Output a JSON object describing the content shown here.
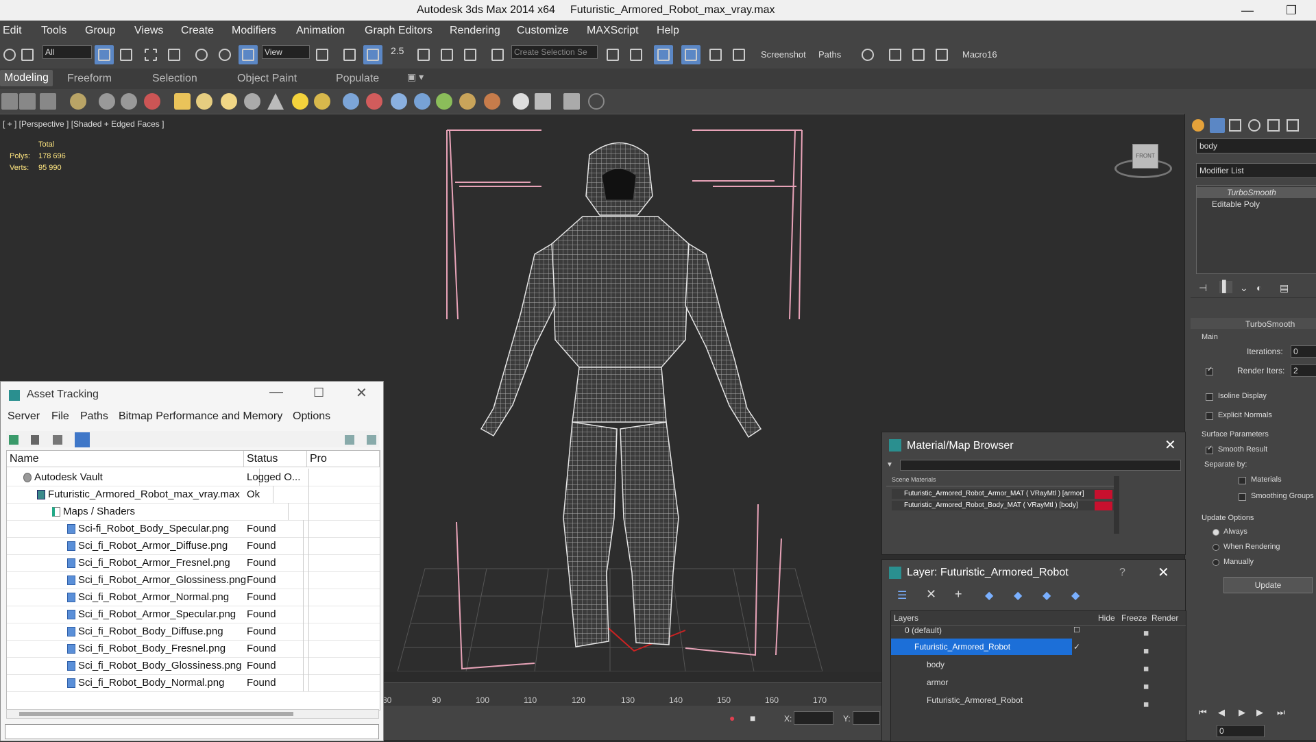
{
  "window": {
    "app_title": "Autodesk 3ds Max  2014 x64",
    "file_title": "Futuristic_Armored_Robot_max_vray.max",
    "minimize": "—",
    "maximize": "❐"
  },
  "menubar": [
    "Edit",
    "Tools",
    "Group",
    "Views",
    "Create",
    "Modifiers",
    "Animation",
    "Graph Editors",
    "Rendering",
    "Customize",
    "MAXScript",
    "Help"
  ],
  "toolbar": {
    "selection_filter": "All",
    "view_dropdown": "View",
    "snap_label": "2.5",
    "selection_set_placeholder": "Create Selection Se",
    "labels": [
      "Screenshot",
      "Paths",
      "Macro16"
    ]
  },
  "ribbon_tabs": [
    "Modeling",
    "Freeform",
    "Selection",
    "Object Paint",
    "Populate"
  ],
  "viewport": {
    "label": "[ + ] [Perspective ] [Shaded + Edged Faces ]",
    "stats_header": "Total",
    "polys_label": "Polys:",
    "polys_value": "178 696",
    "verts_label": "Verts:",
    "verts_value": "95 990",
    "viewcube_label": "FRONT"
  },
  "timeline": {
    "ticks": [
      "80",
      "90",
      "100",
      "110",
      "120",
      "130",
      "140",
      "150",
      "160",
      "170"
    ],
    "x_label": "X:",
    "y_label": "Y:"
  },
  "command_panel": {
    "object_name": "body",
    "modifier_list": "Modifier List",
    "stack": [
      "TurboSmooth",
      "Editable Poly"
    ],
    "rollout_title": "TurboSmooth",
    "main_label": "Main",
    "iterations_label": "Iterations:",
    "iterations_value": "0",
    "render_iters_label": "Render Iters:",
    "render_iters_value": "2",
    "isoline_label": "Isoline Display",
    "explicit_normals_label": "Explicit Normals",
    "surface_params_label": "Surface Parameters",
    "smooth_result_label": "Smooth Result",
    "separate_by_label": "Separate by:",
    "materials_label": "Materials",
    "smoothing_groups_label": "Smoothing Groups",
    "update_options_label": "Update Options",
    "always_label": "Always",
    "when_rendering_label": "When Rendering",
    "manually_label": "Manually",
    "update_button": "Update",
    "frame_value": "0"
  },
  "asset_tracking": {
    "title": "Asset Tracking",
    "menu": [
      "Server",
      "File",
      "Paths",
      "Bitmap Performance and Memory",
      "Options"
    ],
    "columns": [
      "Name",
      "Status",
      "Pro"
    ],
    "rows": [
      {
        "name": "Autodesk Vault",
        "status": "Logged O...",
        "indent": 0,
        "icon": "vault"
      },
      {
        "name": "Futuristic_Armored_Robot_max_vray.max",
        "status": "Ok",
        "indent": 1,
        "icon": "max"
      },
      {
        "name": "Maps / Shaders",
        "status": "",
        "indent": 2,
        "icon": "folder"
      },
      {
        "name": "Sci-fi_Robot_Body_Specular.png",
        "status": "Found",
        "indent": 3,
        "icon": "file"
      },
      {
        "name": "Sci_fi_Robot_Armor_Diffuse.png",
        "status": "Found",
        "indent": 3,
        "icon": "file"
      },
      {
        "name": "Sci_fi_Robot_Armor_Fresnel.png",
        "status": "Found",
        "indent": 3,
        "icon": "file"
      },
      {
        "name": "Sci_fi_Robot_Armor_Glossiness.png",
        "status": "Found",
        "indent": 3,
        "icon": "file"
      },
      {
        "name": "Sci_fi_Robot_Armor_Normal.png",
        "status": "Found",
        "indent": 3,
        "icon": "file"
      },
      {
        "name": "Sci_fi_Robot_Armor_Specular.png",
        "status": "Found",
        "indent": 3,
        "icon": "file"
      },
      {
        "name": "Sci_fi_Robot_Body_Diffuse.png",
        "status": "Found",
        "indent": 3,
        "icon": "file"
      },
      {
        "name": "Sci_fi_Robot_Body_Fresnel.png",
        "status": "Found",
        "indent": 3,
        "icon": "file"
      },
      {
        "name": "Sci_fi_Robot_Body_Glossiness.png",
        "status": "Found",
        "indent": 3,
        "icon": "file"
      },
      {
        "name": "Sci_fi_Robot_Body_Normal.png",
        "status": "Found",
        "indent": 3,
        "icon": "file"
      }
    ]
  },
  "material_browser": {
    "title": "Material/Map Browser",
    "group": "Scene Materials",
    "materials": [
      "Futuristic_Armored_Robot_Armor_MAT ( VRayMtl ) [armor]",
      "Futuristic_Armored_Robot_Body_MAT ( VRayMtl ) [body]"
    ]
  },
  "layer_window": {
    "title": "Layer: Futuristic_Armored_Robot",
    "help": "?",
    "columns": [
      "Layers",
      "Hide",
      "Freeze",
      "Render"
    ],
    "rows": [
      {
        "name": "0 (default)",
        "indent": 0,
        "selected": false
      },
      {
        "name": "Futuristic_Armored_Robot",
        "indent": 0,
        "selected": true
      },
      {
        "name": "body",
        "indent": 1,
        "selected": false
      },
      {
        "name": "armor",
        "indent": 1,
        "selected": false
      },
      {
        "name": "Futuristic_Armored_Robot",
        "indent": 1,
        "selected": false
      }
    ]
  },
  "colors": {
    "accent": "#5b87c5",
    "selection": "#1c6fd8",
    "material_swatch": "#c8102e"
  }
}
